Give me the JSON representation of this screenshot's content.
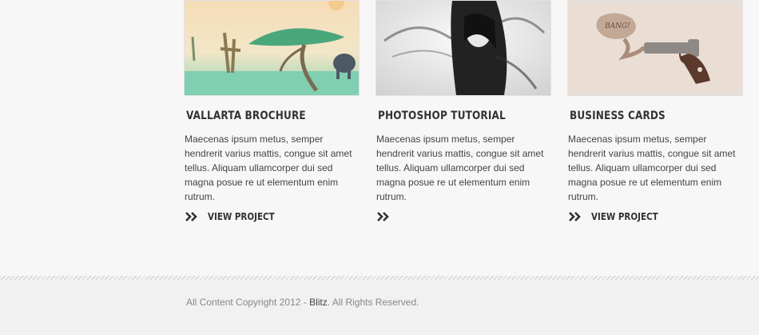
{
  "projects": [
    {
      "title": "Vallarta Brochure",
      "description": "Maecenas ipsum metus, semper hendrerit varius mattis, congue sit amet tellus. Aliquam ullamcorper dui sed magna posue re ut elementum enim rutrum.",
      "link_label": "View Project",
      "image": "surreal-giraffe-tree-illustration"
    },
    {
      "title": "Photoshop Tutorial",
      "description": "Maecenas ipsum metus, semper hendrerit varius mattis, congue sit amet tellus. Aliquam ullamcorper dui sed magna posue re ut elementum enim rutrum.",
      "link_label": "",
      "image": "smoke-hair-portrait-photo"
    },
    {
      "title": "Business Cards",
      "description": "Maecenas ipsum metus, semper hendrerit varius mattis, congue sit amet tellus. Aliquam ullamcorper dui sed magna posue re ut elementum enim rutrum.",
      "link_label": "View Project",
      "image": "bang-pistol-illustration"
    }
  ],
  "footer": {
    "copyright_prefix": "All Content Copyright 2012 - ",
    "brand": "Blitz",
    "copyright_suffix": ". All Rights Reserved."
  },
  "colors": {
    "background": "#f7f7f7",
    "title": "#333333",
    "body_text": "#444444",
    "footer_text": "#888888"
  }
}
